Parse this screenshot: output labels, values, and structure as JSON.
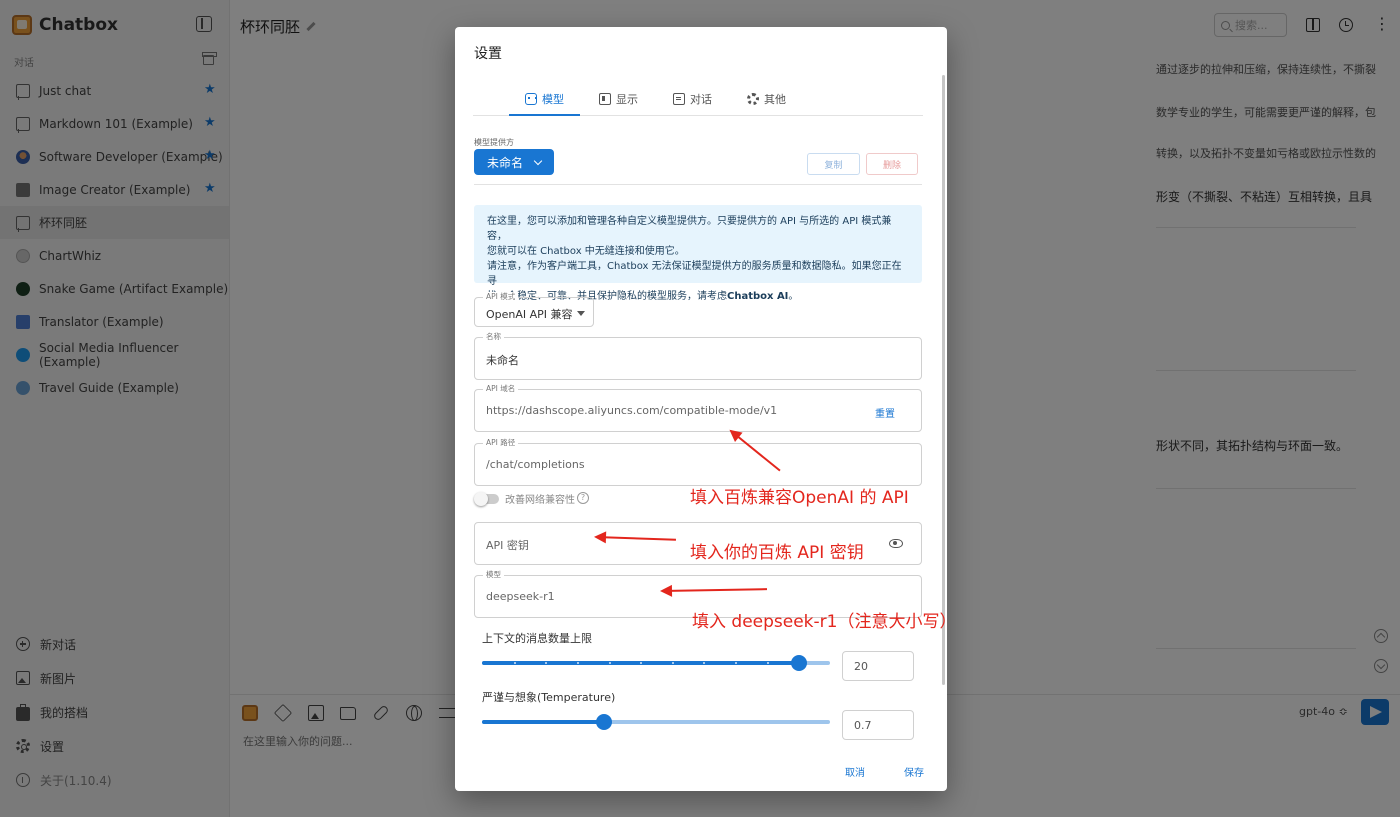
{
  "app": {
    "name": "Chatbox",
    "section_label": "对话",
    "conversations": [
      {
        "label": "Just chat",
        "starred": true
      },
      {
        "label": "Markdown 101 (Example)",
        "starred": true
      },
      {
        "label": "Software Developer (Example)",
        "starred": true
      },
      {
        "label": "Image Creator (Example)",
        "starred": true
      },
      {
        "label": "杯环同胚",
        "starred": false
      },
      {
        "label": "ChartWhiz",
        "starred": false
      },
      {
        "label": "Snake Game (Artifact Example)",
        "starred": false
      },
      {
        "label": "Translator (Example)",
        "starred": false
      },
      {
        "label": "Social Media Influencer (Example)",
        "starred": false
      },
      {
        "label": "Travel Guide (Example)",
        "starred": false
      }
    ],
    "star_glyph": "★",
    "bottom_items": {
      "new_chat": "新对话",
      "new_image": "新图片",
      "my_copilots": "我的搭档",
      "settings": "设置",
      "about": "关于(1.10.4)"
    }
  },
  "main": {
    "chat_title": "杯环同胚",
    "search_placeholder": "搜索...",
    "more_glyph": "⋮",
    "messages": [
      "通过逐步的拉伸和压缩，保持连续性，不撕裂",
      "数学专业的学生，可能需要更严谨的解释，包",
      "转换，以及拓扑不变量如亏格或欧拉示性数的",
      "形变（不撕裂、不粘连）互相转换，且具",
      "形状不同，其拓扑结构与环面一致。"
    ],
    "input_placeholder": "在这里输入你的问题...",
    "model_selector": "gpt-4o ≎"
  },
  "dialog": {
    "title": "设置",
    "tabs": {
      "model": "模型",
      "display": "显示",
      "chat": "对话",
      "other": "其他"
    },
    "provider_label": "模型提供方",
    "provider_value": "未命名",
    "copy_button": "复制",
    "delete_button": "删除",
    "notice": {
      "line1a": "在这里，您可以添加和管理各种自定义模型提供方。只要提供方的 API 与所选的 API 模式兼容，",
      "line1b": "您就可以在 Chatbox 中无缝连接和使用它。",
      "line2a": "请注意，作为客户端工具，Chatbox 无法保证模型提供方的服务质量和数据隐私。如果您正在寻",
      "line2b_pre": "找一个稳定、可靠、并且保护隐私的模型服务，请考虑",
      "line2b_bold": "Chatbox AI",
      "line2b_post": "。"
    },
    "api_mode": {
      "label": "API 模式",
      "value": "OpenAI API 兼容"
    },
    "name_field": {
      "label": "名称",
      "value": "未命名"
    },
    "api_host": {
      "label": "API 域名",
      "value": "https://dashscope.aliyuncs.com/compatible-mode/v1",
      "reset": "重置"
    },
    "api_path": {
      "label": "API 路径",
      "value": "/chat/completions"
    },
    "compat_toggle": {
      "label": "改善网络兼容性",
      "help": "?",
      "enabled": false
    },
    "api_key": {
      "placeholder": "API 密钥"
    },
    "model_field": {
      "label": "模型",
      "value": "deepseek-r1"
    },
    "context_slider": {
      "label": "上下文的消息数量上限",
      "value": "20",
      "position": 0.91
    },
    "temperature_slider": {
      "label": "严谨与想象(Temperature)",
      "value": "0.7",
      "position": 0.35
    },
    "cancel": "取消",
    "save": "保存"
  },
  "annotations": {
    "host_note": "填入百炼兼容OpenAI 的 API",
    "key_note": "填入你的百炼 API 密钥",
    "model_note": "填入 deepseek-r1（注意大小写）",
    "color": "#e3261d"
  },
  "colors": {
    "accent": "#1976d2",
    "notice_bg": "#e6f4fd",
    "overlay": "rgba(0,0,0,0.5)"
  }
}
